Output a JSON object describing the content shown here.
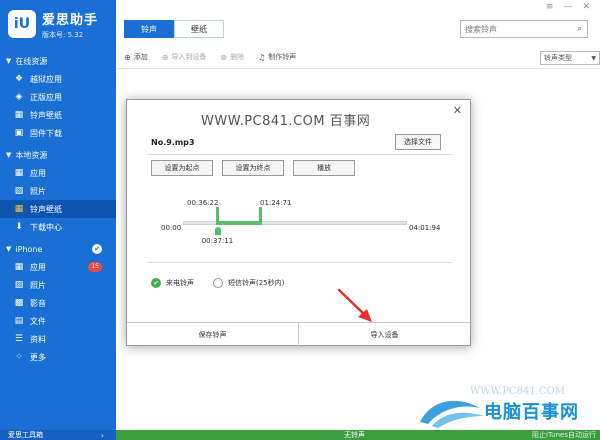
{
  "app": {
    "logo_glyph": "iU",
    "name": "爱思助手",
    "version": "版本号: 5.32"
  },
  "window_controls": {
    "menu": "≡",
    "minimize": "—",
    "close": "✕"
  },
  "sidebar": {
    "sections": [
      {
        "title": "在线资源",
        "items": [
          {
            "label": "越狱应用",
            "icon": "dropbox-icon",
            "glyph": "❖"
          },
          {
            "label": "正版应用",
            "icon": "app-store-icon",
            "glyph": "◈"
          },
          {
            "label": "铃声壁纸",
            "icon": "ringtone-icon",
            "glyph": "▦"
          },
          {
            "label": "固件下载",
            "icon": "firmware-icon",
            "glyph": "▣"
          }
        ]
      },
      {
        "title": "本地资源",
        "items": [
          {
            "label": "应用",
            "icon": "apps-icon",
            "glyph": "▦"
          },
          {
            "label": "照片",
            "icon": "photo-icon",
            "glyph": "▨"
          },
          {
            "label": "铃声壁纸",
            "icon": "ringtone-icon",
            "glyph": "▦",
            "active": true
          },
          {
            "label": "下载中心",
            "icon": "download-icon",
            "glyph": "⬇"
          }
        ]
      },
      {
        "title": "iPhone",
        "items": [
          {
            "label": "应用",
            "icon": "apps-icon",
            "glyph": "▦",
            "badge": "15"
          },
          {
            "label": "照片",
            "icon": "photo-icon",
            "glyph": "▨"
          },
          {
            "label": "影音",
            "icon": "media-icon",
            "glyph": "▩"
          },
          {
            "label": "文件",
            "icon": "file-icon",
            "glyph": "▤"
          },
          {
            "label": "资料",
            "icon": "info-icon",
            "glyph": "☰"
          },
          {
            "label": "更多",
            "icon": "more-icon",
            "glyph": "⁘"
          }
        ]
      }
    ],
    "footer": "爱思工具箱"
  },
  "tabs": [
    {
      "label": "铃声",
      "active": true
    },
    {
      "label": "壁纸",
      "active": false
    }
  ],
  "search": {
    "placeholder": "搜索铃声"
  },
  "toolbar": {
    "items": [
      {
        "label": "添加",
        "icon": "add-icon",
        "glyph": "⊕",
        "disabled": false
      },
      {
        "label": "导入到设备",
        "icon": "import-icon",
        "glyph": "⊕",
        "disabled": true
      },
      {
        "label": "删除",
        "icon": "delete-icon",
        "glyph": "⊗",
        "disabled": true
      },
      {
        "label": "制作铃声",
        "icon": "bell-icon",
        "glyph": "♫",
        "disabled": false
      }
    ],
    "type_select": "铃声类型"
  },
  "dialog": {
    "title": "WWW.PC841.COM 百事网",
    "file_name": "No.9.mp3",
    "choose_file": "选择文件",
    "set_start": "设置为起点",
    "set_end": "设置为终点",
    "play": "播放",
    "time_start": "00:00",
    "time_end": "04:01:94",
    "sel_start": "00:36:22",
    "sel_end": "01:24:71",
    "playhead": "00:37:11",
    "selection_fraction": {
      "start": 0.15,
      "end": 0.35,
      "playhead": 0.155
    },
    "option_call": "来电铃声",
    "option_sms": "短信铃声(25秒内)",
    "save_btn": "保存铃声",
    "import_btn": "导入设备"
  },
  "bottom_bar": {
    "status": "无铃声",
    "right": "阻止iTunes自动运行"
  },
  "watermark": {
    "url": "WWW.PC841.COM",
    "name": "电脑百事网"
  },
  "colors": {
    "sidebar": "#1a6fd4",
    "accent_green": "#5bbe6b",
    "status_bar": "#3a9e3f",
    "arrow_red": "#e8302a"
  }
}
